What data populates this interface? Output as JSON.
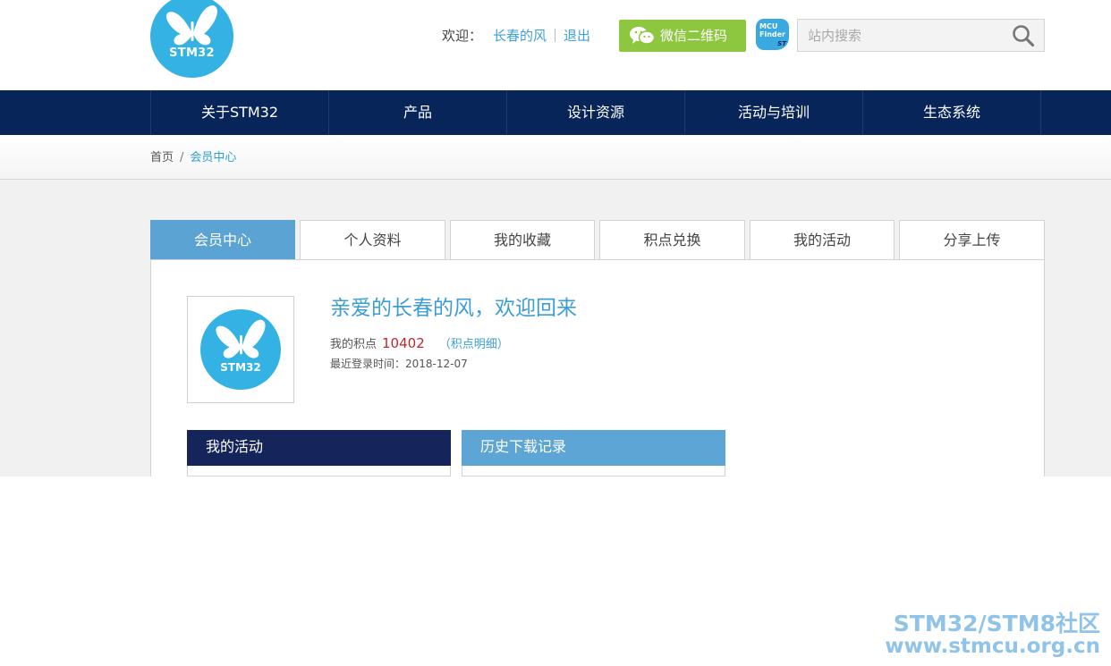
{
  "header": {
    "logo_text": "STM32",
    "welcome_label": "欢迎：",
    "username": "长春的风",
    "logout_label": "退出",
    "wechat_button_label": "微信二维码",
    "mcu_finder_line1": "MCU",
    "mcu_finder_line2": "Finder",
    "mcu_finder_brand": "ST",
    "search_placeholder": "站内搜索"
  },
  "nav": {
    "items": [
      {
        "label": "关于STM32"
      },
      {
        "label": "产品"
      },
      {
        "label": "设计资源"
      },
      {
        "label": "活动与培训"
      },
      {
        "label": "生态系统"
      }
    ]
  },
  "breadcrumb": {
    "home": "首页",
    "separator": "/",
    "current": "会员中心"
  },
  "tabs": [
    {
      "label": "会员中心",
      "active": true
    },
    {
      "label": "个人资料",
      "active": false
    },
    {
      "label": "我的收藏",
      "active": false
    },
    {
      "label": "积点兑换",
      "active": false
    },
    {
      "label": "我的活动",
      "active": false
    },
    {
      "label": "分享上传",
      "active": false
    }
  ],
  "profile": {
    "avatar_text": "STM32",
    "greeting": "亲爱的长春的风，欢迎回来",
    "points_label": "我的积点",
    "points_value": "10402",
    "points_detail": "（积点明细）",
    "last_login": "最近登录时间：2018-12-07"
  },
  "boxes": {
    "activities_title": "我的活动",
    "downloads_title": "历史下载记录"
  },
  "watermark": {
    "line1": "STM32/STM8社区",
    "line2": "www.stmcu.org.cn"
  },
  "colors": {
    "nav_bg": "#08255a",
    "accent_blue": "#3d9ed4",
    "wechat_green": "#8dc63f",
    "logo_blue": "#33b2e3",
    "points_red": "#c0262c"
  }
}
